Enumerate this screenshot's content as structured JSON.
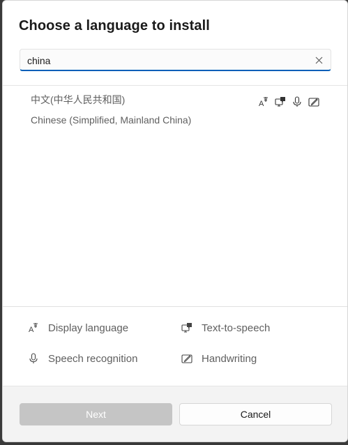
{
  "dialog": {
    "title": "Choose a language to install",
    "search": {
      "value": "china",
      "placeholder": ""
    },
    "result": {
      "native_name": "中文(中华人民共和国)",
      "english_name": "Chinese (Simplified, Mainland China)",
      "feature_icons": [
        "display-language-icon",
        "text-to-speech-icon",
        "speech-recognition-icon",
        "handwriting-icon"
      ]
    },
    "legend": {
      "display_language": "Display language",
      "text_to_speech": "Text-to-speech",
      "speech_recognition": "Speech recognition",
      "handwriting": "Handwriting"
    },
    "buttons": {
      "next": "Next",
      "cancel": "Cancel"
    }
  },
  "colors": {
    "accent": "#005fb8",
    "disabled_button": "#c5c5c5",
    "footer_bg": "#f3f3f3"
  }
}
